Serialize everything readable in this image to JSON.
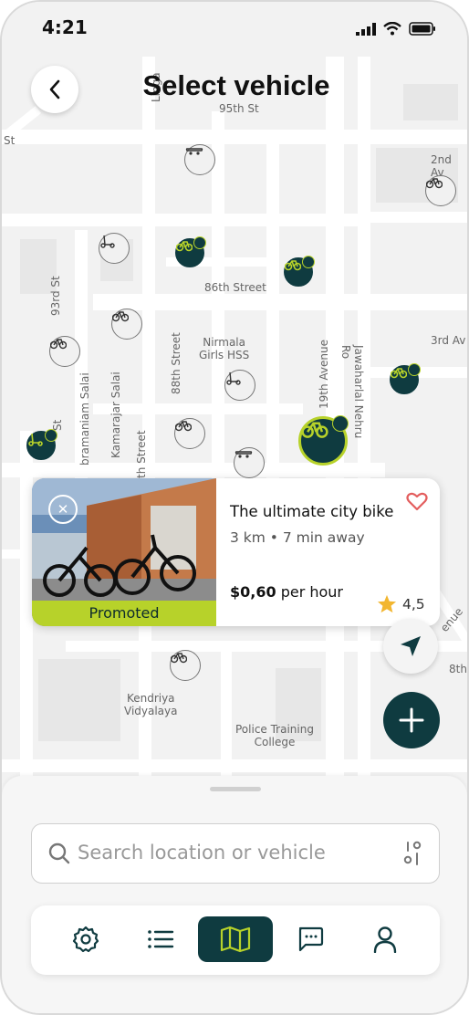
{
  "status": {
    "time": "4:21"
  },
  "header": {
    "title": "Select vehicle"
  },
  "map": {
    "labels": {
      "95th": "95th St",
      "linga": "Linga",
      "st_left": "St",
      "second_av": "2nd Av",
      "third_av": "3rd Av",
      "s86": "86th Street",
      "s93": "93rd St",
      "nirmala": "Nirmala\nGirls HSS",
      "s88": "88th Street",
      "s19": "19th Avenue",
      "jnr": "Jawaharlal Nehru Ro",
      "kamarajar": "Kamarajar Salai",
      "subramaniam": "bramaniam Salai",
      "st_left2": "St",
      "th_street": "th Street",
      "kendriya": "Kendriya\nVidyalaya",
      "police": "Police Training\nCollege",
      "enue": "enue",
      "eighth": "8th"
    }
  },
  "card": {
    "promoted": "Promoted",
    "title": "The ultimate city bike",
    "distance": "3 km • 7 min away",
    "price": "$0,60",
    "price_unit": " per hour",
    "rating": "4,5"
  },
  "search": {
    "placeholder": "Search location or vehicle"
  },
  "tabs": [
    {
      "name": "settings-icon"
    },
    {
      "name": "list-icon"
    },
    {
      "name": "map-icon"
    },
    {
      "name": "chat-icon"
    },
    {
      "name": "profile-icon"
    }
  ],
  "colors": {
    "primary": "#0f3b40",
    "accent": "#b7d22a",
    "heart": "#e35d5d",
    "star": "#f2b630"
  }
}
